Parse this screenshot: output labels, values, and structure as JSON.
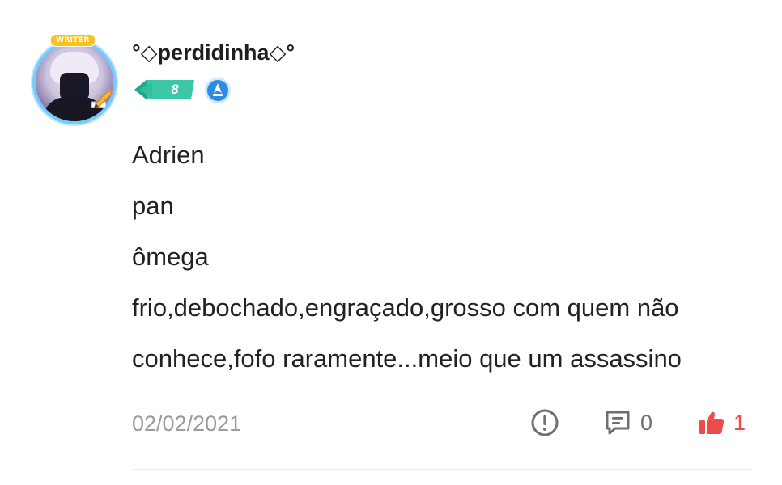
{
  "comment": {
    "author": {
      "username": "°◇perdidinha◇°",
      "avatar_badge": "WRITER",
      "level": "8"
    },
    "lines": [
      "Adrien",
      "pan",
      "ômega",
      "frio,debochado,engraçado,grosso com quem não",
      "conhece,fofo raramente...meio que um assassino"
    ],
    "date": "02/02/2021",
    "actions": {
      "report_icon": "alert-circle-icon",
      "reply_icon": "comment-icon",
      "reply_count": "0",
      "like_icon": "thumbs-up-icon",
      "like_count": "1"
    }
  },
  "colors": {
    "text": "#222222",
    "muted": "#9b9b9b",
    "icon_gray": "#6f6f6f",
    "like_red": "#ee4b4b",
    "level_teal": "#3cc7a9",
    "role_blue": "#2f8be0",
    "divider": "#ececec"
  }
}
